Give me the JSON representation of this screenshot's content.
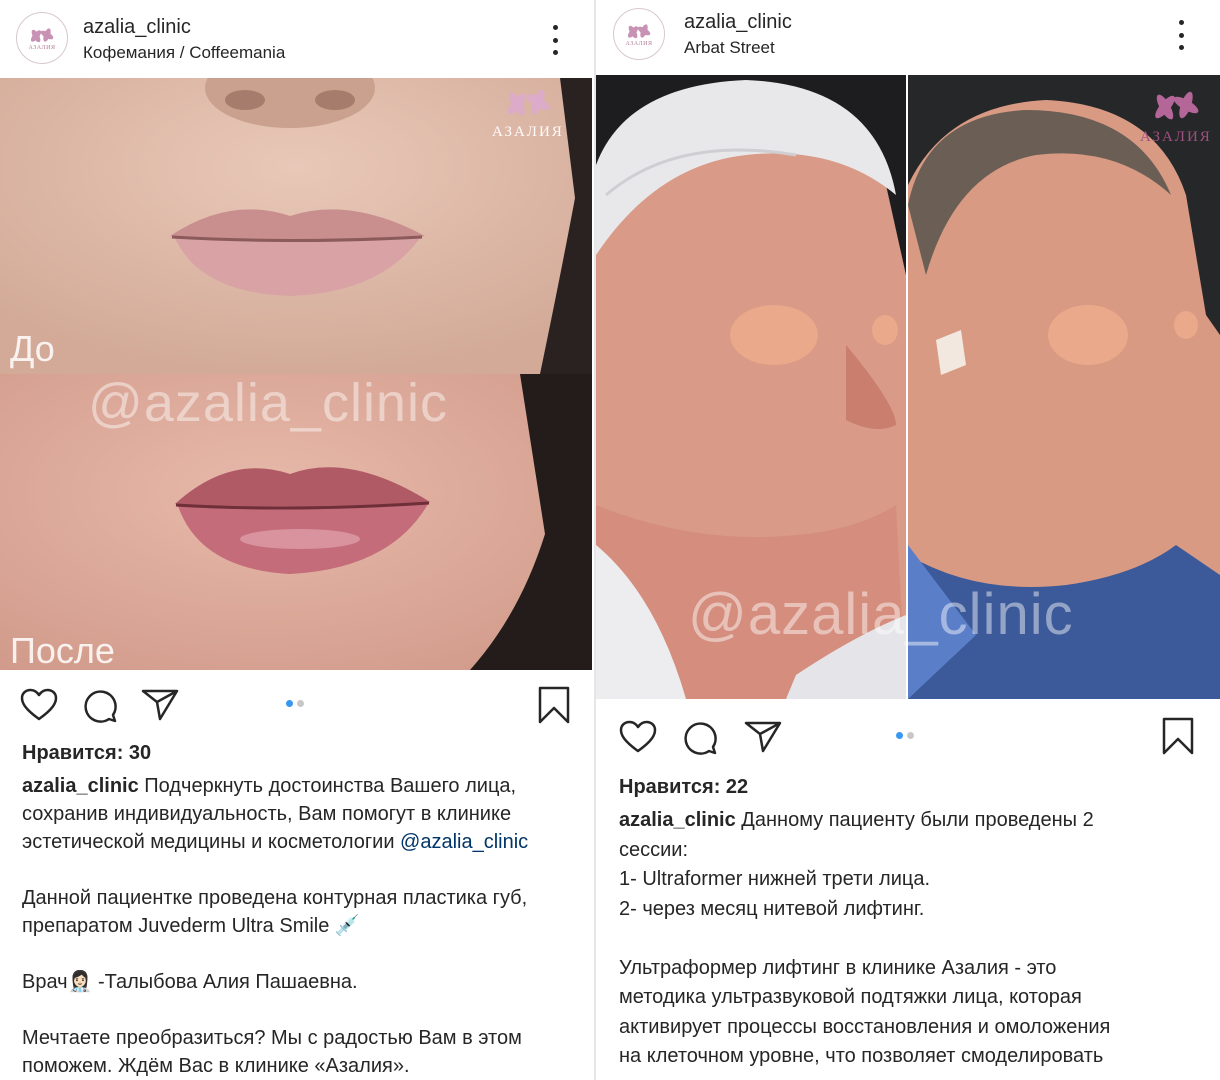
{
  "post1": {
    "username": "azalia_clinic",
    "location": "Кофемания / Coffeemania",
    "avatar_text": "АЗАЛИЯ",
    "brand_text": "АЗАЛИЯ",
    "before_label": "До",
    "after_label": "После",
    "watermark": "@azalia_clinic",
    "likes": "Нравится: 30",
    "caption": {
      "username": "azalia_clinic",
      "line1": " Подчеркнуть достоинства Вашего лица,",
      "line2": "сохранив индивидуальность, Вам помогут в клинике",
      "line3a": "эстетической медицины и косметологии ",
      "mention": "@azalia_clinic",
      "p2_line1": "Данной пациентке проведена контурная пластика губ,",
      "p2_line2": "препаратом Juvederm Ultra Smile 💉",
      "p3": "Врач👩🏻‍⚕️ -Талыбова Алия Пашаевна.",
      "p4_line1": "Мечтаете преобразиться? Мы с радостью Вам в этом",
      "p4_line2": "поможем. Ждём Вас в клинике «Азалия»."
    }
  },
  "post2": {
    "username": "azalia_clinic",
    "location": "Arbat Street",
    "avatar_text": "АЗАЛИЯ",
    "brand_text": "АЗАЛИЯ",
    "watermark": "@azalia_clinic",
    "likes": "Нравится: 22",
    "caption": {
      "username": "azalia_clinic",
      "line1": " Данному пациенту были проведены 2",
      "line2": "сессии:",
      "line3": "1- Ultraformer нижней трети лица.",
      "line4": "2- через месяц нитевой лифтинг.",
      "p2_line1": "Ультраформер лифтинг в клинике  Азалия - это",
      "p2_line2": "методика ультразвуковой подтяжки лица, которая",
      "p2_line3": "активирует процессы восстановления и омоложения",
      "p2_line4": "на клеточном уровне, что позволяет смоделировать"
    }
  },
  "colors": {
    "text": "#262626",
    "mention": "#003569",
    "dot_active": "#3897f0",
    "dot_inactive": "#c7c7c7",
    "brand_pink": "#b07a95"
  },
  "icons": [
    "heart-icon",
    "comment-icon",
    "share-icon",
    "bookmark-icon",
    "more-options-icon",
    "azalia-flower-logo"
  ]
}
